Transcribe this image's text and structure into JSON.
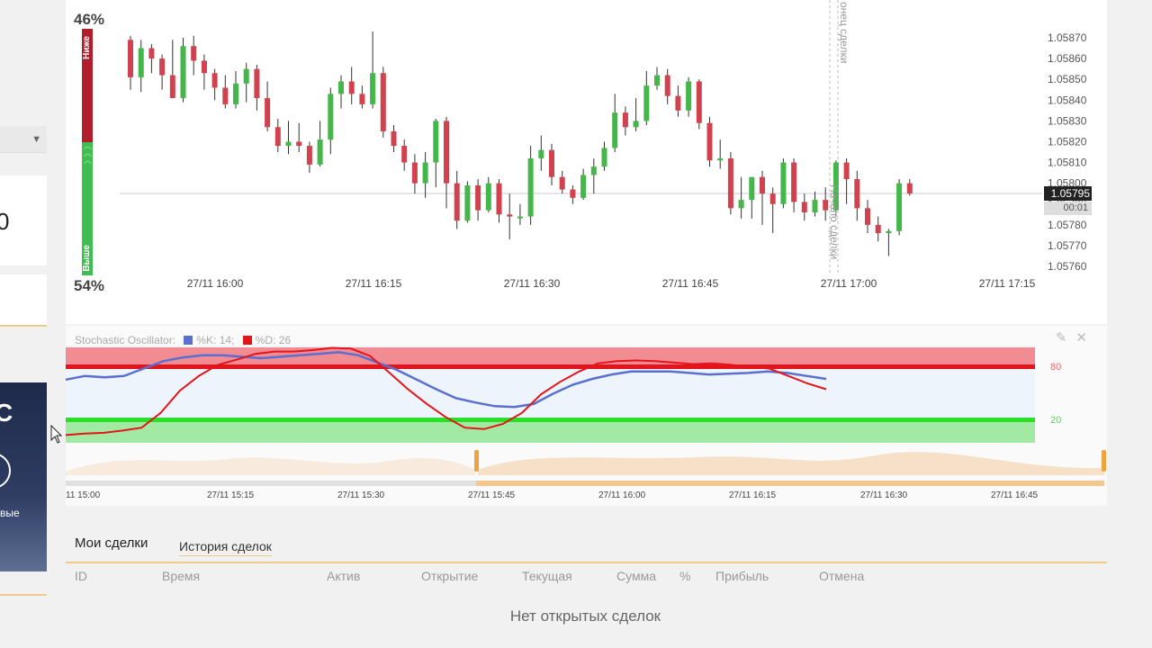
{
  "sidebar": {
    "partial_value": "0",
    "promo_letter": "C",
    "promo_text": "вые"
  },
  "sentiment": {
    "down_percent": "46%",
    "up_percent": "54%",
    "down_label": "Ниже",
    "up_label": "Выше",
    "down_fraction": 0.46,
    "up_fraction": 0.54,
    "down_color": "#b01e2b",
    "up_color": "#3fbf4f"
  },
  "price_axis": [
    "1.05870",
    "1.05860",
    "1.05850",
    "1.05840",
    "1.05830",
    "1.05820",
    "1.05810",
    "1.05800",
    "1.05790",
    "1.05780",
    "1.05770",
    "1.05760"
  ],
  "time_axis": [
    "27/11 16:00",
    "27/11 16:15",
    "27/11 16:30",
    "27/11 16:45",
    "27/11 17:00",
    "27/11 17:15"
  ],
  "current": {
    "price": "1.05795",
    "timer": "00:01"
  },
  "markers": {
    "deal_end": "онец сделки",
    "deal_start": "Начало сделки"
  },
  "oscillator": {
    "title": "Stochastic Oscillator:",
    "k_label": "%K: 14;",
    "d_label": "%D: 26",
    "k_color": "#5b6fd1",
    "d_color": "#e3141b",
    "level_high": "80",
    "level_low": "20"
  },
  "navigator_times": [
    "11 15:00",
    "27/11 15:15",
    "27/11 15:30",
    "27/11 15:45",
    "27/11 16:00",
    "27/11 16:15",
    "27/11 16:30",
    "27/11 16:45"
  ],
  "trades": {
    "tab_my": "Мои сделки",
    "tab_history": "История сделок",
    "columns": [
      "ID",
      "Время",
      "Актив",
      "Открытие",
      "Текущая",
      "Сумма",
      "%",
      "Прибыль",
      "Отмена"
    ],
    "empty_message": "Нет открытых сделок"
  },
  "icons": {
    "dropdown": "chevron-down-icon",
    "edit": "pencil-icon",
    "close": "close-icon",
    "cursor": "mouse-pointer-icon"
  },
  "colors": {
    "bull": "#45b649",
    "bear": "#d0424d",
    "accent": "#f1c98a"
  }
}
